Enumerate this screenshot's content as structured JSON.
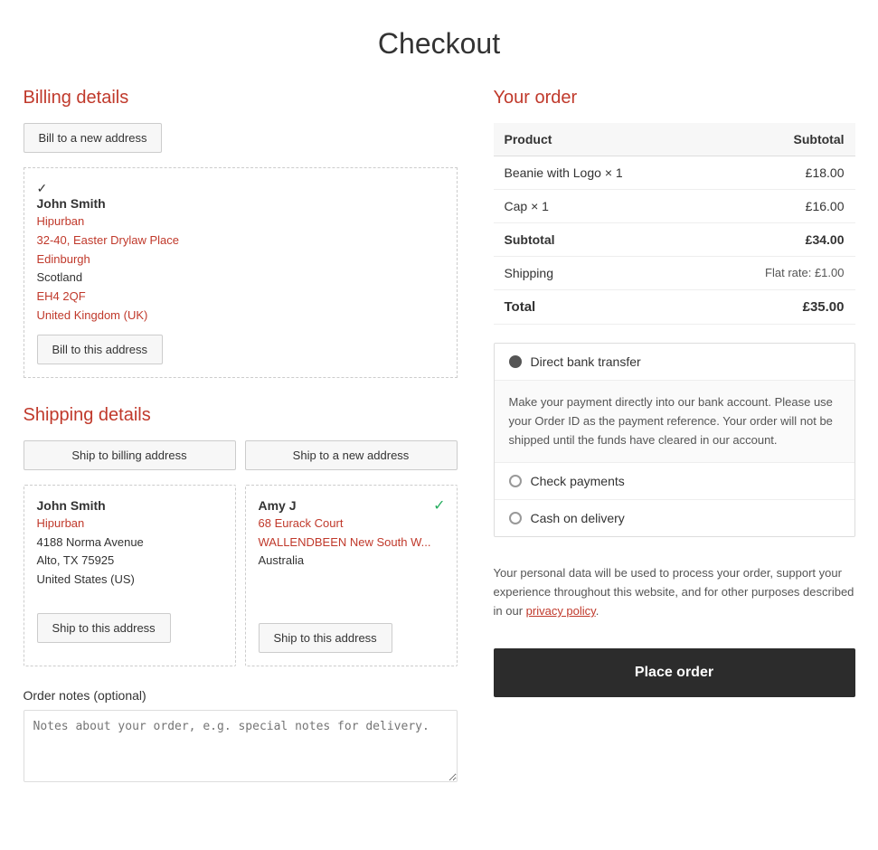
{
  "page": {
    "title": "Checkout"
  },
  "billing": {
    "section_title": "Billing details",
    "new_address_btn": "Bill to a new address",
    "address": {
      "name": "John Smith",
      "line1": "Hipurban",
      "line2": "32-40, Easter Drylaw Place",
      "city": "Edinburgh",
      "region": "Scotland",
      "postcode": "EH4 2QF",
      "country": "United Kingdom (UK)"
    },
    "bill_to_btn": "Bill to this address"
  },
  "shipping": {
    "section_title": "Shipping details",
    "ship_billing_btn": "Ship to billing address",
    "new_address_btn": "Ship to a new address",
    "addresses": [
      {
        "name": "John Smith",
        "line1": "Hipurban",
        "line2": "4188 Norma Avenue",
        "city_state": "Alto, TX 75925",
        "country": "United States (US)",
        "btn": "Ship to this address"
      },
      {
        "name": "Amy J",
        "line1": "68 Eurack Court",
        "line2": "WALLENDBEEN New South W...",
        "country": "Australia",
        "btn": "Ship to this address",
        "selected": true
      }
    ]
  },
  "order_notes": {
    "label": "Order notes (optional)",
    "placeholder": "Notes about your order, e.g. special notes for delivery."
  },
  "your_order": {
    "title": "Your order",
    "table_headers": [
      "Product",
      "Subtotal"
    ],
    "items": [
      {
        "name": "Beanie with Logo",
        "qty": "× 1",
        "subtotal": "£18.00"
      },
      {
        "name": "Cap",
        "qty": "× 1",
        "subtotal": "£16.00"
      }
    ],
    "subtotal_label": "Subtotal",
    "subtotal_value": "£34.00",
    "shipping_label": "Shipping",
    "shipping_value": "Flat rate: £1.00",
    "total_label": "Total",
    "total_value": "£35.00"
  },
  "payment": {
    "options": [
      {
        "label": "Direct bank transfer",
        "selected": true
      },
      {
        "label": "Check payments",
        "selected": false
      },
      {
        "label": "Cash on delivery",
        "selected": false
      }
    ],
    "bank_transfer_desc": "Make your payment directly into our bank account. Please use your Order ID as the payment reference. Your order will not be shipped until the funds have cleared in our account.",
    "privacy_text_before": "Your personal data will be used to process your order, support your experience throughout this website, and for other purposes described in our ",
    "privacy_link": "privacy policy",
    "privacy_text_after": ".",
    "place_order_btn": "Place order"
  }
}
